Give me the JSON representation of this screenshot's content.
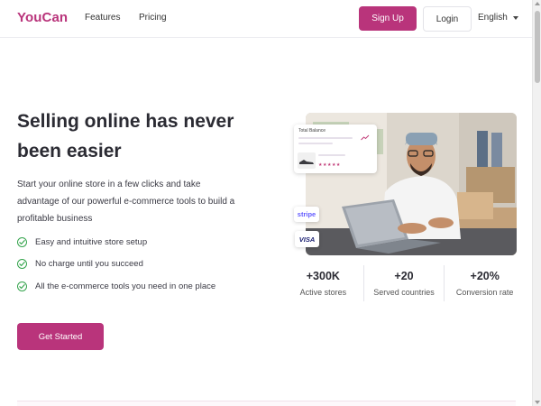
{
  "header": {
    "logo": "YouCan",
    "nav": [
      "Features",
      "Pricing"
    ],
    "signup_label": "Sign Up",
    "login_label": "Login",
    "language": "English"
  },
  "hero": {
    "title": "Selling online has never been easier",
    "subtitle": "Start your online store in a few clicks and take advantage of our powerful e-commerce tools to build a profitable business",
    "features": [
      "Easy and intuitive store setup",
      "No charge until you succeed",
      "All the e-commerce tools you need in one place"
    ],
    "cta_label": "Get Started"
  },
  "card": {
    "balance_label": "Total Balance",
    "stars": "★★★★★"
  },
  "payment_badges": [
    "stripe",
    "VISA"
  ],
  "stats": [
    {
      "value": "+300K",
      "label": "Active stores"
    },
    {
      "value": "+20",
      "label": "Served countries"
    },
    {
      "value": "+20%",
      "label": "Conversion rate"
    }
  ],
  "colors": {
    "brand": "#b9347b",
    "check": "#35a44d"
  }
}
